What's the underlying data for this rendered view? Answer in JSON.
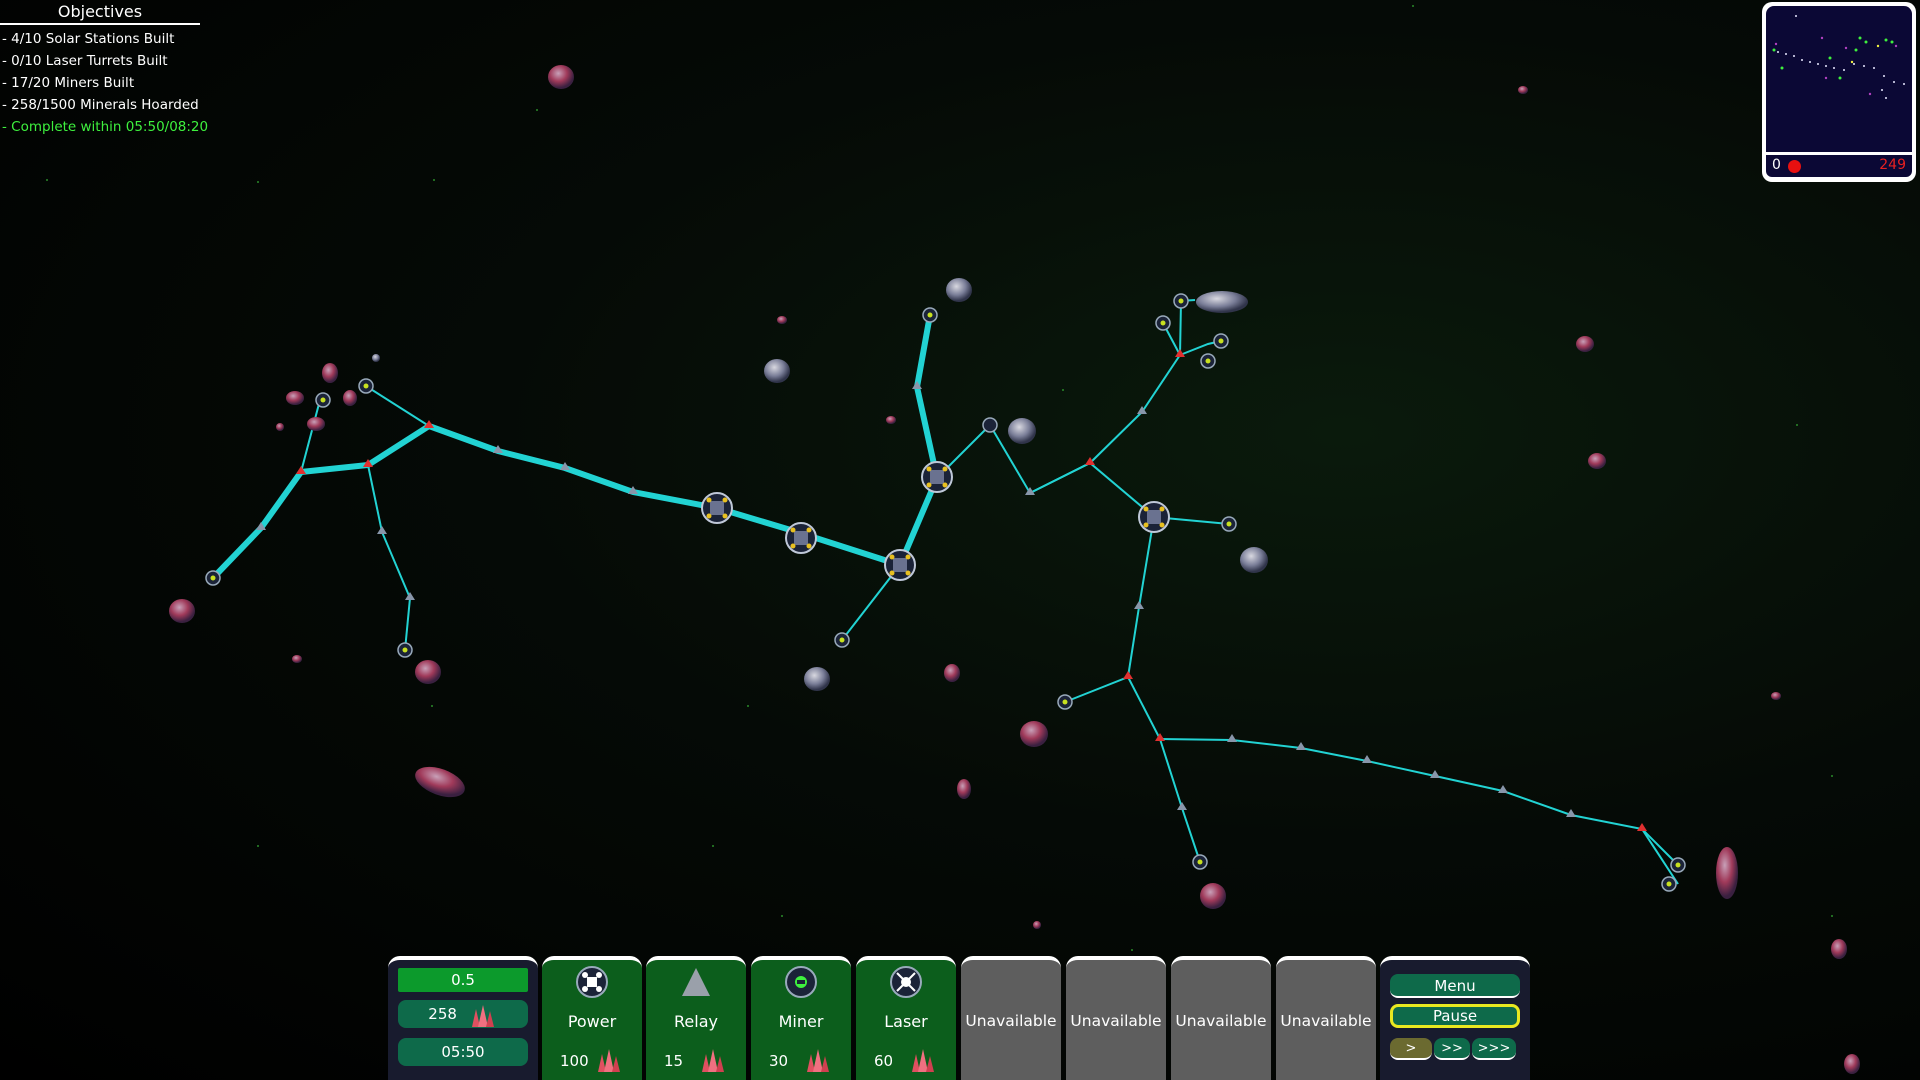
{
  "objectives": {
    "title": "Objectives",
    "items": [
      "- 4/10 Solar Stations Built",
      "- 0/10 Laser Turrets Built",
      "- 17/20 Miners Built",
      "- 258/1500 Minerals Hoarded"
    ],
    "timer": "- Complete within 05:50/08:20"
  },
  "minimap": {
    "left_value": "0",
    "right_value": "249",
    "colors": {
      "background": "#0b0835",
      "enemy_dot": "#e81010"
    }
  },
  "stats": {
    "rate": "0.5",
    "minerals": "258",
    "time": "05:50"
  },
  "build_buttons": [
    {
      "label": "Power",
      "cost": "100",
      "icon": "power-station-icon"
    },
    {
      "label": "Relay",
      "cost": "15",
      "icon": "relay-triangle-icon"
    },
    {
      "label": "Miner",
      "cost": "30",
      "icon": "miner-icon"
    },
    {
      "label": "Laser",
      "cost": "60",
      "icon": "laser-icon"
    }
  ],
  "unavailable_buttons": [
    "Unavailable",
    "Unavailable",
    "Unavailable",
    "Unavailable"
  ],
  "controls": {
    "menu": "Menu",
    "pause": "Pause",
    "speeds": [
      ">",
      ">>",
      ">>>"
    ]
  },
  "colors": {
    "link": "#22d3d3",
    "build_bg": "#0c5e1c",
    "unavailable_bg": "#5e5e5e",
    "button_teal": "#0e6a4a",
    "objective_timer": "#3ef03e",
    "pause_outline": "#e8e820"
  }
}
